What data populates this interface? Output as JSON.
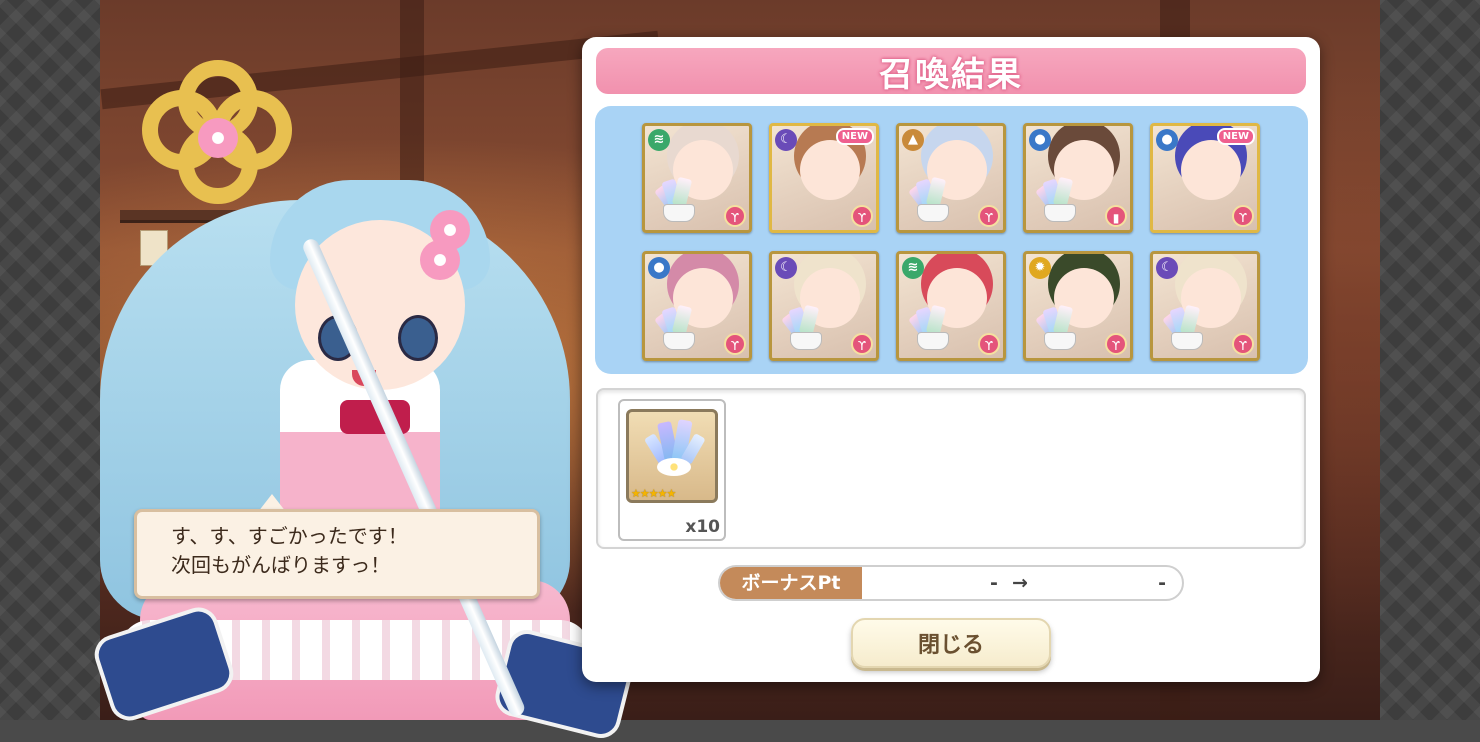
{
  "window": {
    "panel_title": "召喚結果"
  },
  "dialogue": {
    "line1": "す、す、すごかったです！",
    "line2": "次回もがんばりますっ！"
  },
  "results": {
    "cards": [
      {
        "element": "wind",
        "element_color": "#3aa86a",
        "hair": "#e8d9d0",
        "role": "staff",
        "is_new": false,
        "has_crystal": true,
        "frame": "silver"
      },
      {
        "element": "moon",
        "element_color": "#6a4bb8",
        "hair": "#b77a52",
        "role": "staff",
        "is_new": true,
        "has_crystal": false,
        "frame": "gold"
      },
      {
        "element": "earth",
        "element_color": "#c98a3a",
        "hair": "#c6d6ee",
        "role": "staff",
        "is_new": false,
        "has_crystal": true,
        "frame": "silver"
      },
      {
        "element": "water",
        "element_color": "#3a78c8",
        "hair": "#6a4a3a",
        "role": "shield",
        "is_new": false,
        "has_crystal": true,
        "frame": "silver"
      },
      {
        "element": "water",
        "element_color": "#3a78c8",
        "hair": "#4a4ab8",
        "role": "staff",
        "is_new": true,
        "has_crystal": false,
        "frame": "gold"
      },
      {
        "element": "water",
        "element_color": "#3a78c8",
        "hair": "#d48aa8",
        "role": "staff",
        "is_new": false,
        "has_crystal": true,
        "frame": "silver"
      },
      {
        "element": "moon",
        "element_color": "#6a4bb8",
        "hair": "#efe3cc",
        "role": "staff",
        "is_new": false,
        "has_crystal": true,
        "frame": "silver"
      },
      {
        "element": "wind",
        "element_color": "#3aa86a",
        "hair": "#d84a5a",
        "role": "staff",
        "is_new": false,
        "has_crystal": true,
        "frame": "silver"
      },
      {
        "element": "sun",
        "element_color": "#e0a820",
        "hair": "#3a4a2a",
        "role": "staff",
        "is_new": false,
        "has_crystal": true,
        "frame": "silver"
      },
      {
        "element": "moon",
        "element_color": "#6a4bb8",
        "hair": "#efe3cc",
        "role": "staff",
        "is_new": false,
        "has_crystal": true,
        "frame": "silver"
      }
    ],
    "new_label": "NEW"
  },
  "items": [
    {
      "icon": "crystal-bouquet-icon",
      "rarity_stars": "★★★★★",
      "count": "x10"
    }
  ],
  "bonus": {
    "label": "ボーナスPt",
    "from": "-",
    "arrow": "→",
    "to": "-"
  },
  "buttons": {
    "close": "閉じる"
  },
  "colors": {
    "title_pink": "#f191ae",
    "grid_blue": "#a9d3f5",
    "bonus_brown": "#c48a5a"
  }
}
